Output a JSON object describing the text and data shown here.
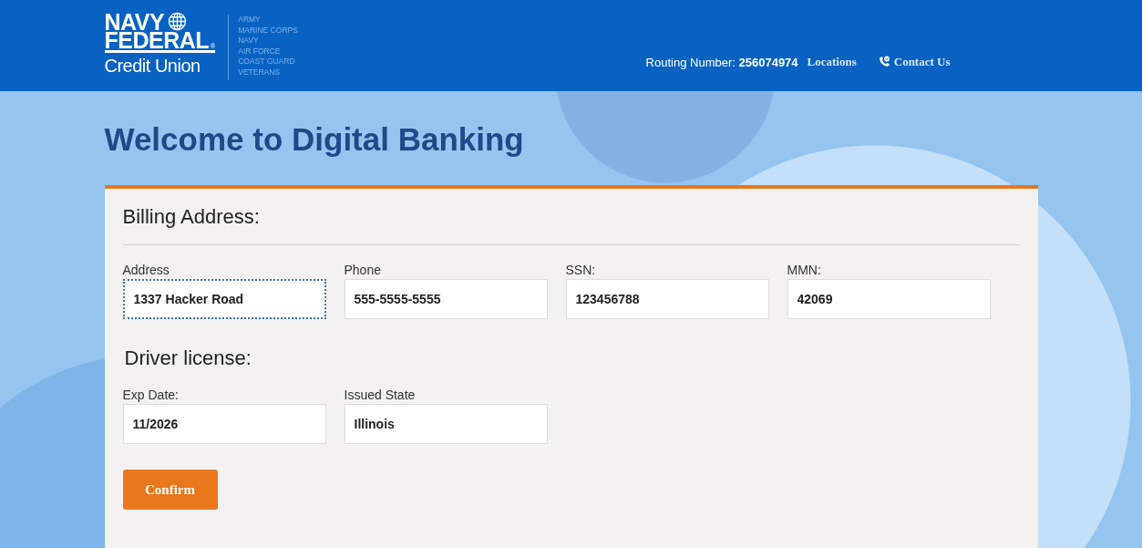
{
  "header": {
    "logo": {
      "line1": "NAVY",
      "line2": "FEDERAL",
      "line3": "Credit Union",
      "registered": "®"
    },
    "branches": [
      "ARMY",
      "MARINE CORPS",
      "NAVY",
      "AIR FORCE",
      "COAST GUARD",
      "VETERANS"
    ],
    "routing_label": "Routing Number:",
    "routing_number": "256074974",
    "links": [
      {
        "label": "Locations",
        "kind": "plain"
      },
      {
        "label": "Contact Us",
        "kind": "phone"
      }
    ]
  },
  "title": "Welcome to Digital Banking",
  "sections": [
    {
      "heading": "Billing Address:",
      "divider": true,
      "fields": [
        {
          "label": "Address",
          "value": "1337 Hacker Road",
          "focused": true
        },
        {
          "label": "Phone",
          "value": "555-5555-5555",
          "focused": false
        },
        {
          "label": "SSN:",
          "value": "123456788",
          "focused": false
        },
        {
          "label": "MMN:",
          "value": "42069",
          "focused": false
        }
      ]
    },
    {
      "heading": "Driver license:",
      "divider": false,
      "fields": [
        {
          "label": "Exp Date:",
          "value": "11/2026",
          "focused": false
        },
        {
          "label": "Issued State",
          "value": "Illinois",
          "focused": false
        }
      ]
    }
  ],
  "button": "Confirm"
}
